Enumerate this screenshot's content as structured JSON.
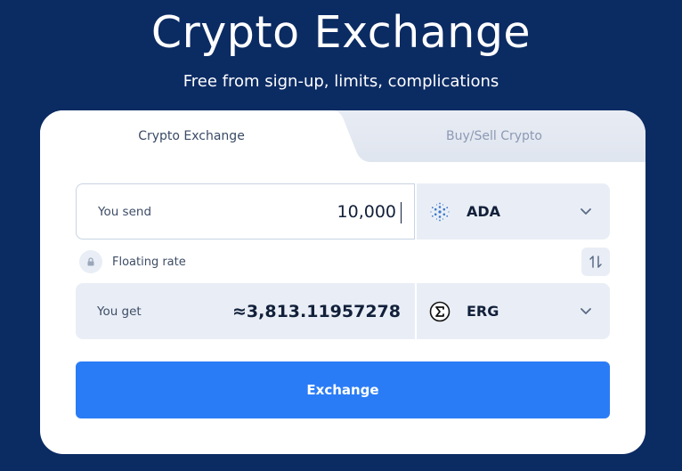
{
  "hero": {
    "title": "Crypto Exchange",
    "subtitle": "Free from sign-up, limits, complications"
  },
  "tabs": [
    {
      "label": "Crypto Exchange",
      "active": true
    },
    {
      "label": "Buy/Sell Crypto",
      "active": false
    }
  ],
  "send": {
    "label": "You send",
    "value": "10,000",
    "currency": {
      "code": "ADA",
      "icon": "cardano-icon"
    }
  },
  "rate": {
    "label": "Floating rate",
    "lock_icon": "lock-icon",
    "swap_icon": "swap-arrows-icon"
  },
  "get": {
    "label": "You get",
    "value": "≈3,813.11957278",
    "currency": {
      "code": "ERG",
      "icon": "ergo-icon"
    }
  },
  "actions": {
    "exchange_label": "Exchange"
  },
  "colors": {
    "background": "#0b2b63",
    "card": "#ffffff",
    "field_bg": "#e9eef6",
    "accent": "#2a7cf6",
    "text_dark": "#12203a",
    "text_muted": "#8c9ab3"
  }
}
